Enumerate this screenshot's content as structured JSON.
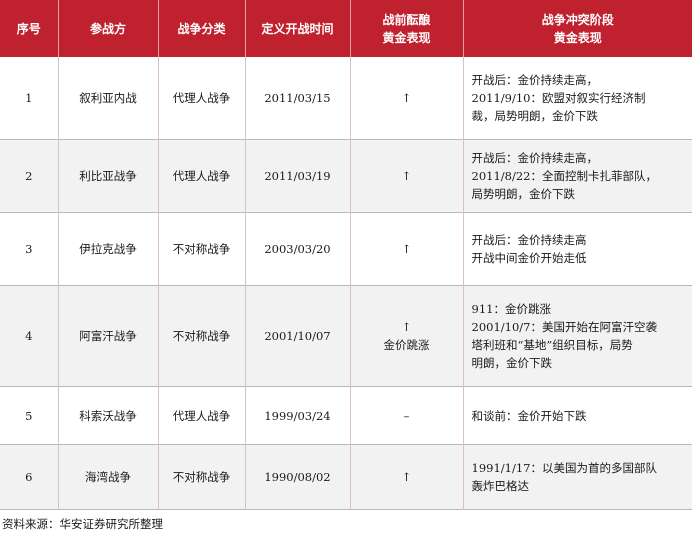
{
  "headers": [
    "序号",
    "参战方",
    "战争分类",
    "定义开战时间",
    "战前酝酿\n黄金表现",
    "战争冲突阶段\n黄金表现"
  ],
  "rows": [
    {
      "no": "1",
      "party": "叙利亚内战",
      "type": "代理人战争",
      "date": "2011/03/15",
      "pre": "↑",
      "conflict": "开战后：金价持续走高，\n2011/9/10：欧盟对叙实行经济制\n裁，局势明朗，金价下跌"
    },
    {
      "no": "2",
      "party": "利比亚战争",
      "type": "代理人战争",
      "date": "2011/03/19",
      "pre": "↑",
      "conflict": "开战后：金价持续走高，\n2011/8/22：全面控制卡扎菲部队，\n局势明朗，金价下跌"
    },
    {
      "no": "3",
      "party": "伊拉克战争",
      "type": "不对称战争",
      "date": "2003/03/20",
      "pre": "↑",
      "conflict": "开战后：金价持续走高\n开战中间金价开始走低"
    },
    {
      "no": "4",
      "party": "阿富汗战争",
      "type": "不对称战争",
      "date": "2001/10/07",
      "pre": "↑\n金价跳涨",
      "conflict": "911：金价跳涨\n2001/10/7：美国开始在阿富汗空袭\n塔利班和“基地”组织目标，局势\n明朗，金价下跌"
    },
    {
      "no": "5",
      "party": "科索沃战争",
      "type": "代理人战争",
      "date": "1999/03/24",
      "pre": "–",
      "conflict": "和谈前：金价开始下跌"
    },
    {
      "no": "6",
      "party": "海湾战争",
      "type": "不对称战争",
      "date": "1990/08/02",
      "pre": "↑",
      "conflict": "1991/1/17：以美国为首的多国部队\n轰炸巴格达"
    }
  ],
  "source": "资料来源：华安证券研究所整理",
  "colors": {
    "header_bg": "#c0212f",
    "header_text": "#ffffff",
    "alt_row": "#f2f2f2"
  }
}
